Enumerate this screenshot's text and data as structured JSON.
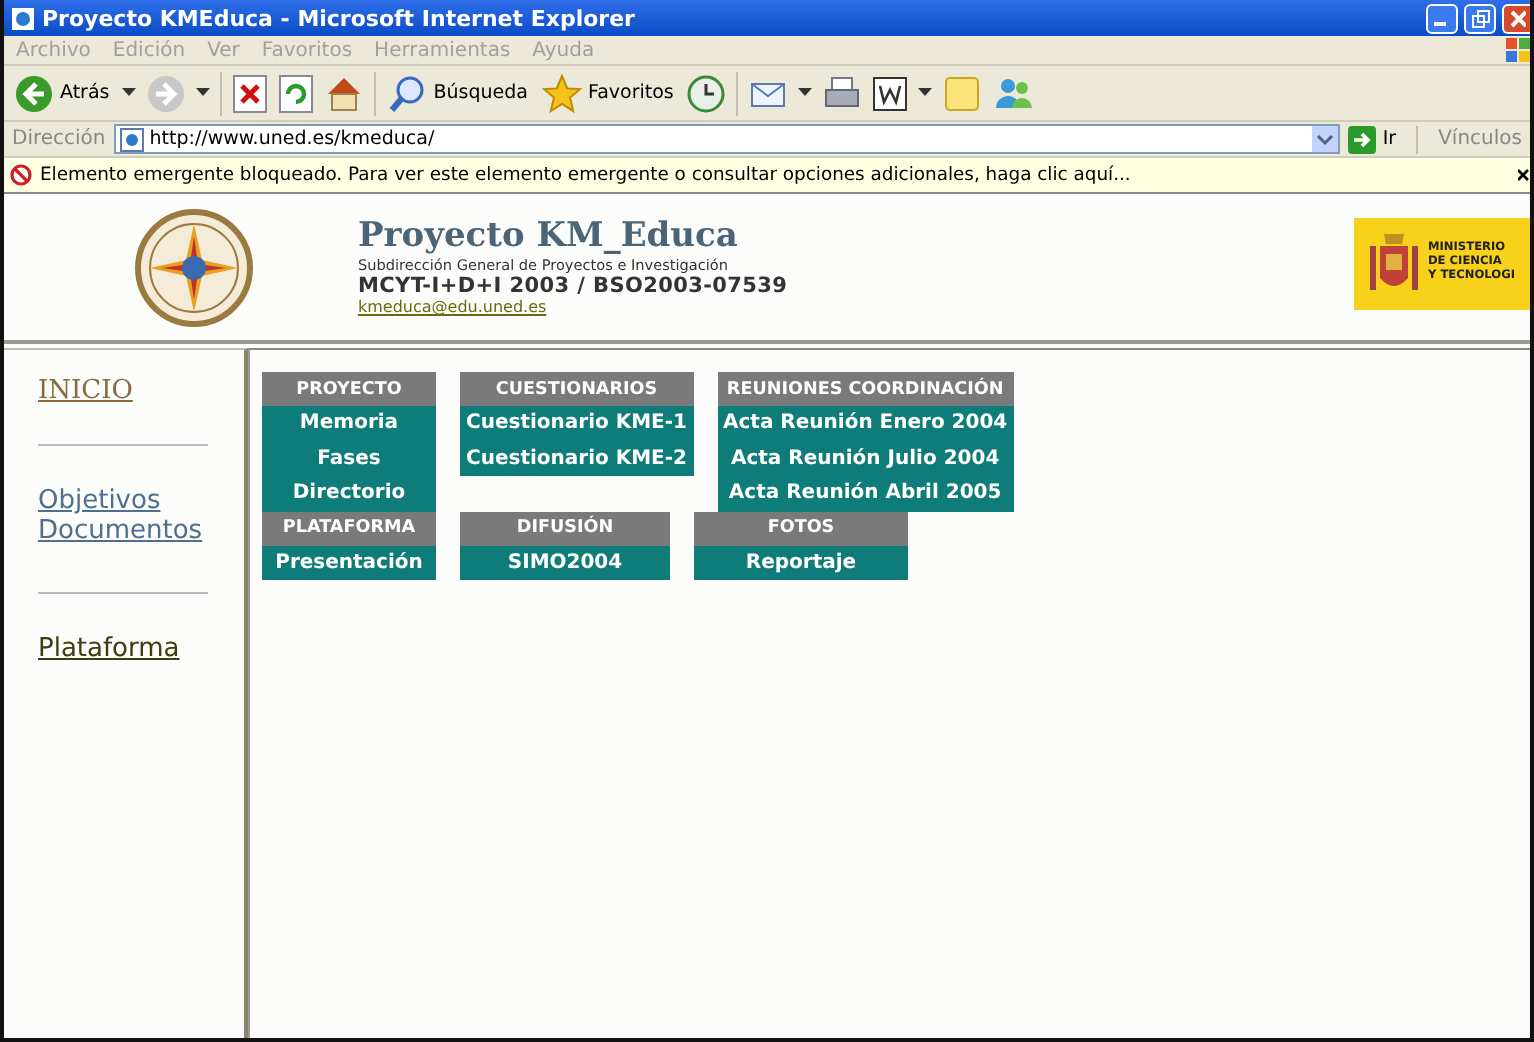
{
  "window": {
    "title": "Proyecto KMEduca - Microsoft Internet Explorer"
  },
  "menu_bar": [
    "Archivo",
    "Edición",
    "Ver",
    "Favoritos",
    "Herramientas",
    "Ayuda"
  ],
  "toolbar": [
    {
      "kind": "back",
      "label": "Atrás"
    },
    {
      "kind": "caret"
    },
    {
      "kind": "forward"
    },
    {
      "kind": "caret"
    },
    {
      "kind": "stop"
    },
    {
      "kind": "refresh"
    },
    {
      "kind": "home"
    },
    {
      "kind": "search",
      "label": "Búsqueda"
    },
    {
      "kind": "favorites",
      "label": "Favoritos"
    },
    {
      "kind": "history"
    },
    {
      "kind": "mail"
    },
    {
      "kind": "caret"
    },
    {
      "kind": "print"
    },
    {
      "kind": "word"
    },
    {
      "kind": "caret"
    },
    {
      "kind": "note"
    },
    {
      "kind": "messenger"
    }
  ],
  "address_bar": {
    "label": "Dirección",
    "url": "http://www.uned.es/kmeduca/",
    "go": "Ir",
    "links": "Vínculos"
  },
  "info_bar": {
    "text": "Elemento emergente bloqueado.  Para ver este elemento emergente o consultar opciones adicionales, haga clic aquí..."
  },
  "header": {
    "title": "Proyecto KM_Educa",
    "subtitle": "Subdirección General de Proyectos e Investigación",
    "code": "MCYT-I+D+I 2003 / BSO2003-07539",
    "email": "kmeduca@edu.uned.es",
    "ministry": [
      "MINISTERIO",
      "DE CIENCIA",
      "Y TECNOLOGI"
    ]
  },
  "sidebar": [
    {
      "kind": "title",
      "label": "INICIO",
      "color": "#8b6b3d"
    },
    {
      "kind": "divider"
    },
    {
      "kind": "link",
      "label": "Objetivos",
      "color": "#4f6f8f"
    },
    {
      "kind": "link",
      "label": "Documentos",
      "color": "#4f6f8f"
    },
    {
      "kind": "divider"
    },
    {
      "kind": "link",
      "label": "Plataforma",
      "color": "#3d3d10"
    }
  ],
  "menu_rows": [
    [
      {
        "heading": "PROYECTO",
        "items": [
          "Memoria",
          "Fases",
          "Directorio"
        ]
      },
      {
        "heading": "CUESTIONARIOS",
        "items": [
          "Cuestionario KME-1",
          "Cuestionario KME-2"
        ]
      },
      {
        "heading": "REUNIONES COORDINACIÓN",
        "items": [
          "Acta Reunión Enero 2004",
          "Acta Reunión Julio 2004",
          "Acta Reunión Abril 2005"
        ]
      }
    ],
    [
      {
        "heading": "PLATAFORMA",
        "items": [
          "Presentación"
        ]
      },
      {
        "heading": "DIFUSIÓN",
        "items": [
          "SIMO2004"
        ]
      },
      {
        "heading": "FOTOS",
        "items": [
          "Reportaje"
        ]
      }
    ]
  ]
}
